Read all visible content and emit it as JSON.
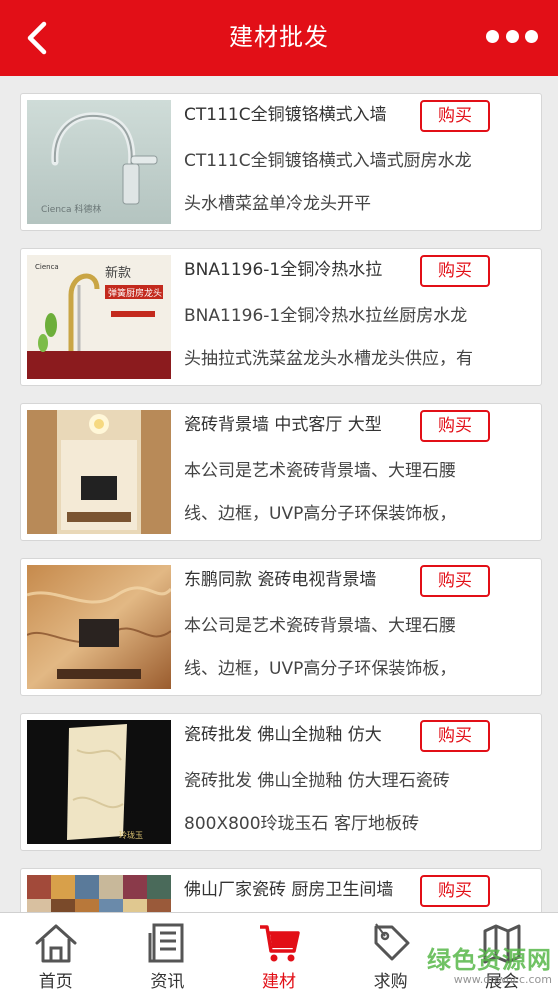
{
  "header": {
    "title": "建材批发",
    "back_icon": "chevron-left-icon",
    "more_icon": "more-dots-icon"
  },
  "products": [
    {
      "name": "CT111C全铜镀铬横式入墙",
      "buy_label": "购买",
      "desc_line1": "CT111C全铜镀铬横式入墙式厨房水龙",
      "desc_line2": "头水槽菜盆单冷龙头开平",
      "thumb_text": "Cienca 科德林"
    },
    {
      "name": "BNA1196-1全铜冷热水拉",
      "buy_label": "购买",
      "desc_line1": "BNA1196-1全铜冷热水拉丝厨房水龙",
      "desc_line2": "头抽拉式洗菜盆龙头水槽龙头供应，有",
      "thumb_text": "新款 弹簧厨房龙头"
    },
    {
      "name": "瓷砖背景墙 中式客厅 大型",
      "buy_label": "购买",
      "desc_line1": "本公司是艺术瓷砖背景墙、大理石腰",
      "desc_line2": "线、边框，UVP高分子环保装饰板，",
      "thumb_text": ""
    },
    {
      "name": "东鹏同款 瓷砖电视背景墙",
      "buy_label": "购买",
      "desc_line1": "本公司是艺术瓷砖背景墙、大理石腰",
      "desc_line2": "线、边框，UVP高分子环保装饰板，",
      "thumb_text": ""
    },
    {
      "name": "瓷砖批发 佛山全抛釉 仿大",
      "buy_label": "购买",
      "desc_line1": "瓷砖批发 佛山全抛釉 仿大理石瓷砖",
      "desc_line2": "800X800玲珑玉石 客厅地板砖",
      "thumb_text": "玲珑玉"
    },
    {
      "name": "佛山厂家瓷砖 厨房卫生间墙",
      "buy_label": "购买",
      "desc_line1": "",
      "desc_line2": "",
      "thumb_text": ""
    }
  ],
  "tabbar": [
    {
      "label": "首页",
      "icon": "home-icon",
      "active": false
    },
    {
      "label": "资讯",
      "icon": "news-icon",
      "active": false
    },
    {
      "label": "建材",
      "icon": "cart-icon",
      "active": true
    },
    {
      "label": "求购",
      "icon": "tag-icon",
      "active": false
    },
    {
      "label": "展会",
      "icon": "map-icon",
      "active": false
    }
  ],
  "watermark": {
    "text": "绿色资源网",
    "url": "www.downcc.com"
  },
  "colors": {
    "brand": "#e20f17",
    "background": "#ececec",
    "watermark": "#58b84a"
  }
}
